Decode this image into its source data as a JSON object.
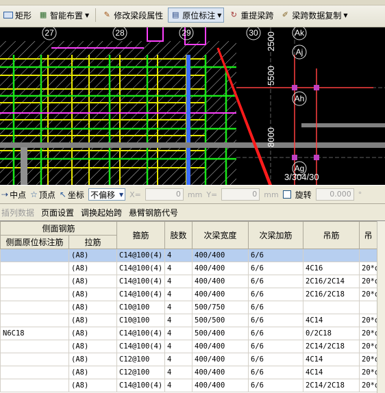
{
  "toolbar": {
    "rect_label": "矩形",
    "smart_layout_label": "智能布置",
    "modify_span_label": "修改梁段属性",
    "origin_label": "原位标注",
    "reextract_label": "重提梁跨",
    "copy_span_label": "梁跨数据复制"
  },
  "cad": {
    "grid_labels": [
      "27",
      "28",
      "29",
      "30",
      "Ak",
      "Aj",
      "Ah",
      "Ag"
    ],
    "dims": [
      "2500",
      "5500",
      "8000"
    ],
    "annotation": "3/304/30"
  },
  "snapbar": {
    "midpoint": "中点",
    "vertex": "顶点",
    "coord": "坐标",
    "offset_mode": "不偏移",
    "x_label": "X=",
    "x_value": "0",
    "y_label": "Y=",
    "y_value": "0",
    "unit": "mm",
    "rotate_label": "旋转",
    "rotate_value": "0.000",
    "deg": "°"
  },
  "menu": [
    "插列数据",
    "页面设置",
    "调换起始跨",
    "悬臂钢筋代号"
  ],
  "table": {
    "group_header": "侧面钢筋",
    "headers": [
      "侧面原位标注筋",
      "拉筋",
      "箍筋",
      "肢数",
      "次梁宽度",
      "次梁加筋",
      "吊筋",
      "吊"
    ],
    "rows": [
      [
        "",
        "(A8)",
        "C14@100(4)",
        "4",
        "400/400",
        "6/6",
        "",
        ""
      ],
      [
        "",
        "(A8)",
        "C14@100(4)",
        "4",
        "400/400",
        "6/6",
        "4C16",
        "20*d"
      ],
      [
        "",
        "(A8)",
        "C14@100(4)",
        "4",
        "400/400",
        "6/6",
        "2C16/2C14",
        "20*d"
      ],
      [
        "",
        "(A8)",
        "C14@100(4)",
        "4",
        "400/400",
        "6/6",
        "2C16/2C18",
        "20*d"
      ],
      [
        "",
        "(A8)",
        "C10@100",
        "4",
        "500/750",
        "6/6",
        "",
        ""
      ],
      [
        "",
        "(A8)",
        "C10@100",
        "4",
        "500/500",
        "6/6",
        "4C14",
        "20*d"
      ],
      [
        "N6C18",
        "(A8)",
        "C14@100(4)",
        "4",
        "500/400",
        "6/6",
        "0/2C18",
        "20*d"
      ],
      [
        "",
        "(A8)",
        "C14@100(4)",
        "4",
        "400/400",
        "6/6",
        "2C14/2C18",
        "20*d"
      ],
      [
        "",
        "(A8)",
        "C12@100",
        "4",
        "400/400",
        "6/6",
        "4C14",
        "20*d"
      ],
      [
        "",
        "(A8)",
        "C12@100",
        "4",
        "400/400",
        "6/6",
        "4C14",
        "20*d"
      ],
      [
        "",
        "(A8)",
        "C14@100(4)",
        "4",
        "400/400",
        "6/6",
        "2C14/2C18",
        "20*d"
      ]
    ]
  }
}
